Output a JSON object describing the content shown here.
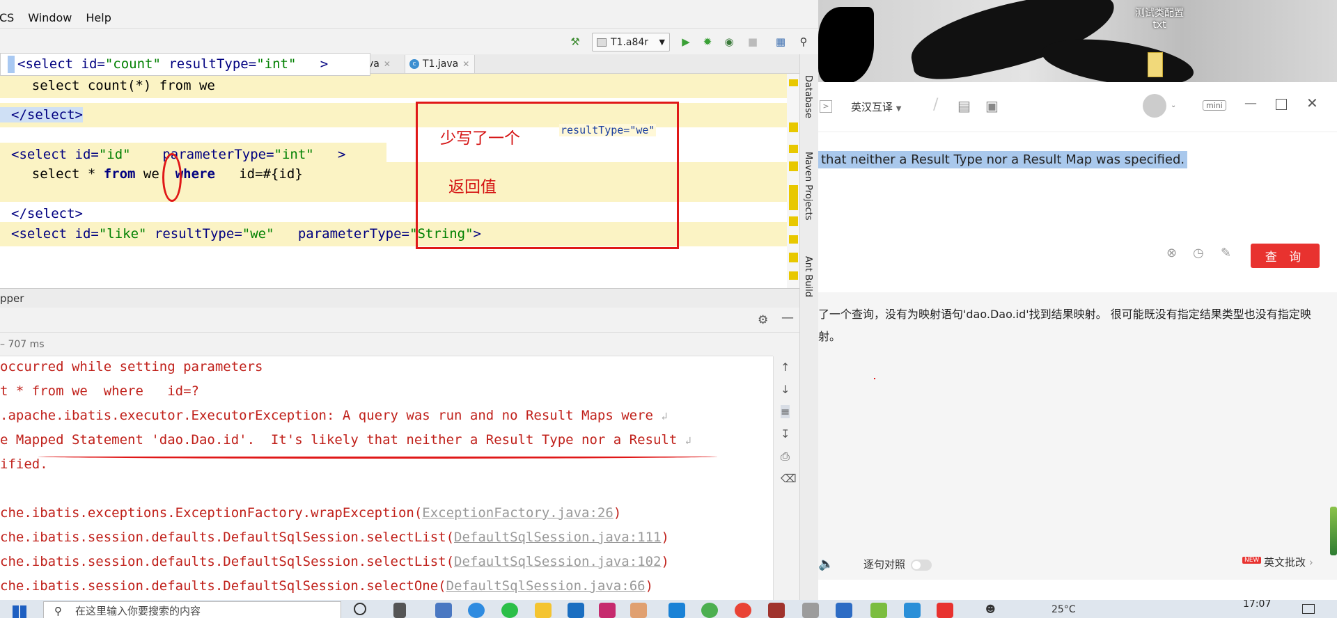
{
  "ide": {
    "menu": [
      "VCS",
      "Window",
      "Help"
    ],
    "run_config": "T1.a84r",
    "tabs": [
      {
        "label": "va"
      },
      {
        "label": "T1.java"
      }
    ],
    "popup_line": {
      "open": "<select id=",
      "id_val": "\"count\"",
      "attr": " resultType=",
      "attr_val": "\"int\"",
      "close": "   >"
    },
    "code": [
      {
        "kind": "sql",
        "text": "    select count(*) from we"
      },
      {
        "kind": "tag",
        "text": "</select>"
      },
      {
        "kind": "select_id",
        "open": "<select id=",
        "id_val": "\"id\"",
        "attr": "    parameterType=",
        "attr_val": "\"int\"",
        "close": "   >"
      },
      {
        "kind": "sql2",
        "a": "    select * ",
        "b": "from",
        "c": " we  ",
        "d": "where",
        "e": "   id=#{id}"
      },
      {
        "kind": "tag",
        "text": "</select>"
      },
      {
        "kind": "select_like",
        "open": "<select id=",
        "id_val": "\"like\"",
        "attr": " resultType=",
        "attr_val": "\"we\"",
        "attr2": "   parameterType=",
        "attr2_val": "\"String\"",
        "close": ">"
      }
    ],
    "annotation": {
      "missing_text": "少写了一个",
      "return_text": "返回值",
      "code_hint": "resultType=\"we\""
    },
    "side_panels": [
      "Database",
      "Maven Projects",
      "Ant Build"
    ],
    "panel_title": "pper",
    "run_time": "– 707 ms",
    "console": [
      {
        "cls": "err",
        "text": "occurred while setting parameters"
      },
      {
        "cls": "err",
        "text": "t * from we  where   id=?"
      },
      {
        "cls": "err",
        "text": ".apache.ibatis.executor.ExecutorException: A query was run and no Result Maps were",
        "wrap": true
      },
      {
        "cls": "err",
        "text": "e Mapped Statement 'dao.Dao.id'.  It's likely that neither a Result Type nor a Result",
        "wrap": true
      },
      {
        "cls": "err",
        "text": "ified."
      },
      {
        "cls": "blank",
        "text": ""
      },
      {
        "cls": "err",
        "text": "che.ibatis.exceptions.ExceptionFactory.wrapException(",
        "link": "ExceptionFactory.java:26",
        "tail": ")"
      },
      {
        "cls": "err",
        "text": "che.ibatis.session.defaults.DefaultSqlSession.selectList(",
        "link": "DefaultSqlSession.java:111",
        "tail": ")"
      },
      {
        "cls": "err",
        "text": "che.ibatis.session.defaults.DefaultSqlSession.selectList(",
        "link": "DefaultSqlSession.java:102",
        "tail": ")"
      },
      {
        "cls": "err",
        "text": "che.ibatis.session.defaults.DefaultSqlSession.selectOne(",
        "link": "DefaultSqlSession.java:66",
        "tail": ")"
      }
    ]
  },
  "translator": {
    "photo_caption": "测试类配置\ntxt",
    "lang_select": "英汉互译",
    "mini_label": "mini",
    "source_text": "that neither a Result Type nor a Result Map was specified.",
    "query_button": "查 询",
    "result_text": "了一个查询，没有为映射语句'dao.Dao.id'找到结果映射。 很可能既没有指定结果类型也没有指定映射。",
    "compare_label": "逐句对照",
    "correction_label": "英文批改",
    "new_badge": "NEW"
  },
  "taskbar": {
    "search_placeholder": "在这里输入你要搜索的内容",
    "temperature": "25°C",
    "time": "17:07"
  }
}
